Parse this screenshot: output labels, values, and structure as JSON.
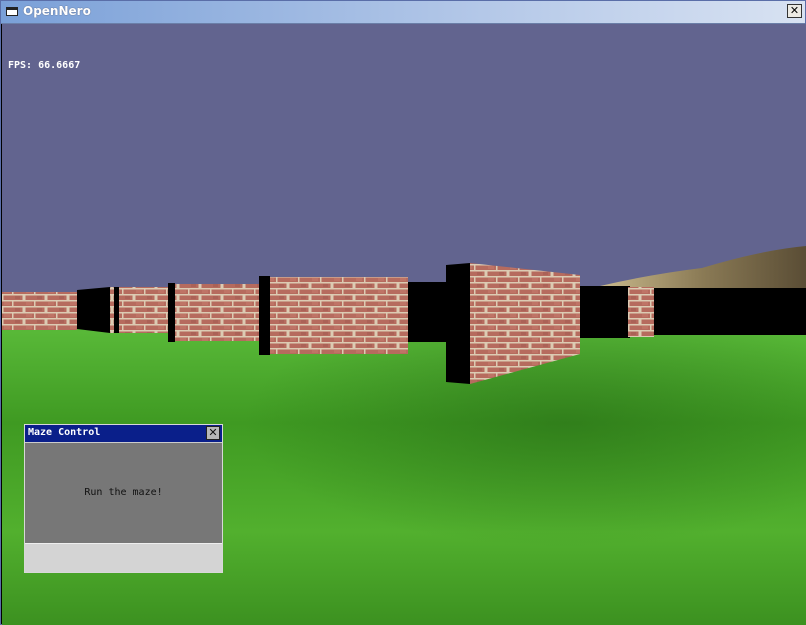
{
  "window": {
    "title": "OpenNero",
    "close_symbol": "✕"
  },
  "hud": {
    "fps": "FPS: 66.6667"
  },
  "scene": {
    "sky_color": "#62648f",
    "ground_color": "#48a52c",
    "wall_color": "#b06a5c",
    "mortar_color": "#d8c8b0"
  },
  "maze_control": {
    "title": "Maze Control",
    "message": "Run the maze!",
    "close_symbol": "✕",
    "title_color": "#0a1f8a"
  }
}
